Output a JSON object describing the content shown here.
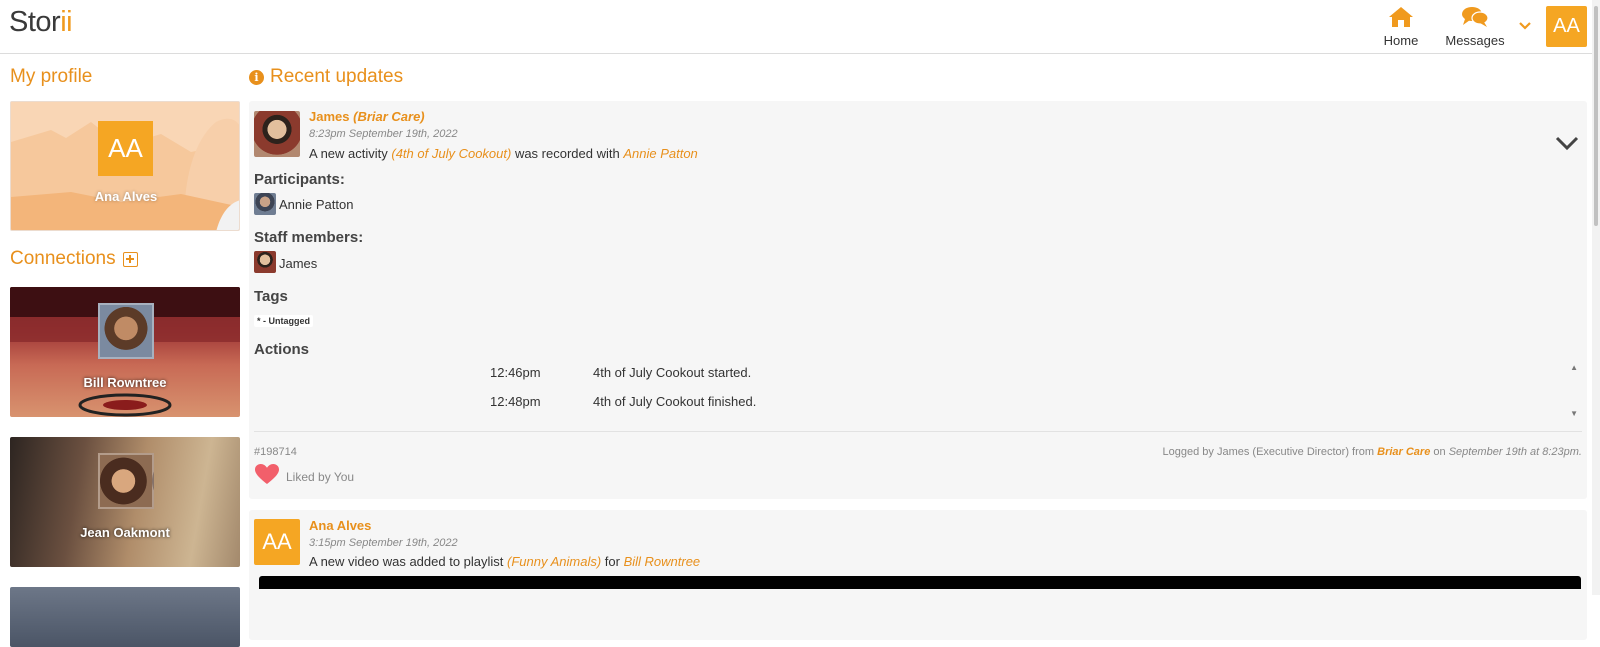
{
  "app": {
    "logo_main": "Stor",
    "logo_accent": "ii",
    "accent_color": "#f09a1e",
    "user_initials": "AA"
  },
  "nav": {
    "home": {
      "label": "Home",
      "icon": "home-icon"
    },
    "messages": {
      "label": "Messages",
      "icon": "chat-bubbles-icon"
    },
    "dropdown_icon": "chevron-down-icon"
  },
  "sidebar": {
    "my_profile_title": "My profile",
    "profile": {
      "initials": "AA",
      "name": "Ana Alves"
    },
    "connections_title": "Connections",
    "connections": [
      {
        "name": "Bill Rowntree"
      },
      {
        "name": "Jean Oakmont"
      },
      {
        "name": ""
      }
    ]
  },
  "main": {
    "recent_title": "Recent updates",
    "posts": [
      {
        "author": "James",
        "org": "(Briar Care)",
        "time": "8:23pm September 19th, 2022",
        "desc_pre": "A new activity ",
        "desc_activity": "(4th of July Cookout)",
        "desc_mid": " was recorded with ",
        "desc_person": "Annie Patton",
        "participants_label": "Participants:",
        "participants": [
          "Annie Patton"
        ],
        "staff_label": "Staff members:",
        "staff": [
          "James"
        ],
        "tags_label": "Tags",
        "tags": [
          "* - Untagged"
        ],
        "actions_label": "Actions",
        "actions": [
          {
            "time": "12:46pm",
            "text": "4th of July Cookout started."
          },
          {
            "time": "12:48pm",
            "text": "4th of July Cookout finished."
          }
        ],
        "id": "#198714",
        "logged_pre": "Logged by James (Executive Director) from ",
        "logged_org": "Briar Care",
        "logged_mid": " on ",
        "logged_when": "September 19th at 8:23pm.",
        "liked_text": "Liked by You"
      },
      {
        "author": "Ana Alves",
        "initials": "AA",
        "time": "3:15pm September 19th, 2022",
        "desc_pre": "A new video was added to playlist ",
        "desc_playlist": "(Funny Animals)",
        "desc_mid": " for ",
        "desc_person": "Bill Rowntree"
      }
    ]
  }
}
